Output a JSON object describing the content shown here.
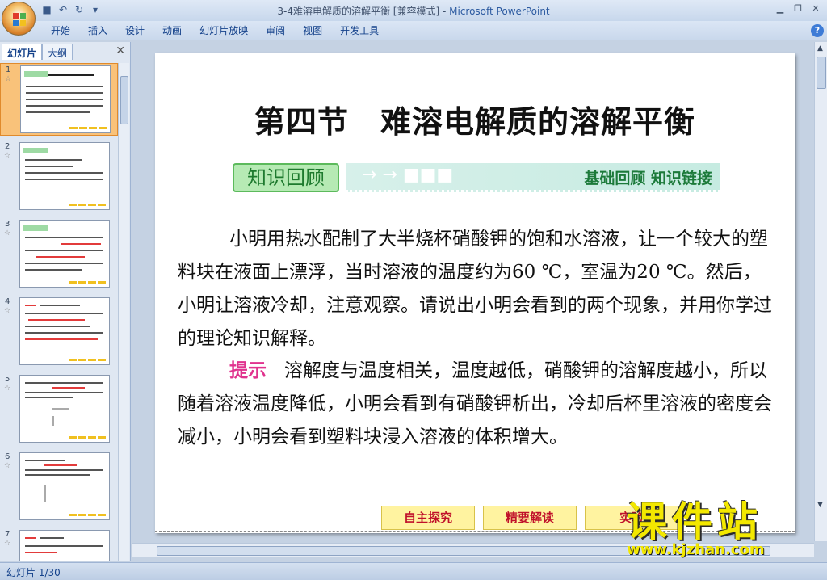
{
  "window": {
    "title": "3-4难溶电解质的溶解平衡 [兼容模式]",
    "app": "Microsoft PowerPoint",
    "title_sep": " - "
  },
  "ribbon": {
    "tabs": [
      "开始",
      "插入",
      "设计",
      "动画",
      "幻灯片放映",
      "审阅",
      "视图",
      "开发工具"
    ]
  },
  "pane": {
    "tabs": [
      "幻灯片",
      "大纲"
    ],
    "thumbnails": [
      {
        "num": "1"
      },
      {
        "num": "2"
      },
      {
        "num": "3"
      },
      {
        "num": "4"
      },
      {
        "num": "5"
      },
      {
        "num": "6"
      },
      {
        "num": "7"
      }
    ]
  },
  "slide": {
    "title": "第四节　难溶电解质的溶解平衡",
    "badge": "知识回顾",
    "tagline": "基础回顾 知识链接",
    "paragraph1": "小明用热水配制了大半烧杯硝酸钾的饱和水溶液，让一个较大的塑料块在液面上漂浮，当时溶液的温度约为60 ℃，室温为20 ℃。然后，小明让溶液冷却，注意观察。请说出小明会看到的两个现象，并用你学过的理论知识解释。",
    "hint_label": "提示",
    "paragraph2": "溶解度与温度相关，温度越低，硝酸钾的溶解度越小，所以随着溶液温度降低，小明会看到有硝酸钾析出，冷却后杯里溶液的密度会减小，小明会看到塑料块浸入溶液的体积增大。",
    "nav_buttons": [
      "自主探究",
      "精要解读",
      "实验"
    ]
  },
  "status": {
    "slide_counter": "幻灯片 1/30"
  },
  "watermark": {
    "text": "课件站",
    "url": "www.kjzhan.com"
  },
  "colors": {
    "hint": "#e0338e",
    "badge_bg": "#b6eab4",
    "tagline": "#1c7a3a",
    "selected_thumb": "#f9c27a"
  }
}
